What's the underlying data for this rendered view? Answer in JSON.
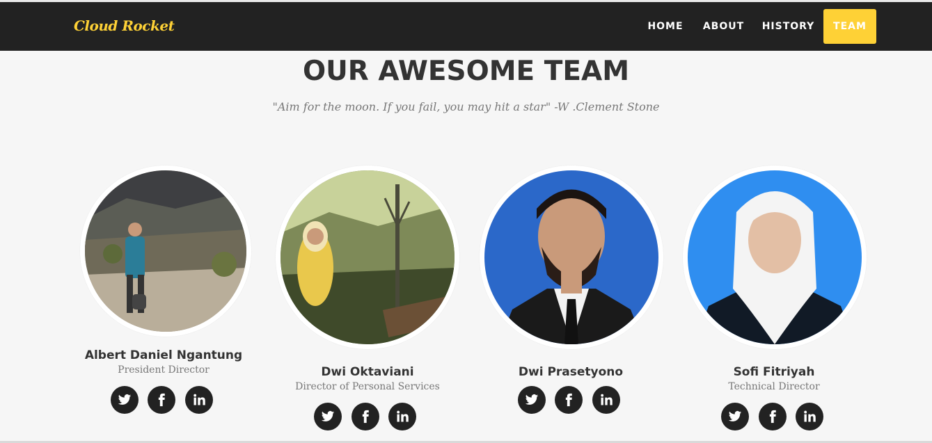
{
  "brand": "Cloud Rocket",
  "nav": {
    "items": [
      {
        "label": "HOME",
        "active": false
      },
      {
        "label": "ABOUT",
        "active": false
      },
      {
        "label": "HISTORY",
        "active": false
      },
      {
        "label": "TEAM",
        "active": true
      }
    ]
  },
  "section": {
    "title": "OUR AWESOME TEAM",
    "subtitle": "\"Aim for the moon. If you fail, you may hit a star\" -W .Clement Stone"
  },
  "team": [
    {
      "name": "Albert Daniel Ngantung",
      "role": "President Director",
      "social": [
        "twitter-icon",
        "facebook-icon",
        "linkedin-icon"
      ]
    },
    {
      "name": "Dwi Oktaviani",
      "role": "Director of Personal Services",
      "social": [
        "twitter-icon",
        "facebook-icon",
        "linkedin-icon"
      ]
    },
    {
      "name": "Dwi Prasetyono",
      "role": "",
      "social": [
        "twitter-icon",
        "facebook-icon",
        "linkedin-icon"
      ]
    },
    {
      "name": "Sofi Fitriyah",
      "role": "Technical Director",
      "social": [
        "twitter-icon",
        "facebook-icon",
        "linkedin-icon"
      ]
    }
  ],
  "colors": {
    "navbar": "#222222",
    "accent": "#fed136",
    "background": "#f6f6f6",
    "heading": "#333333",
    "muted": "#777777"
  }
}
